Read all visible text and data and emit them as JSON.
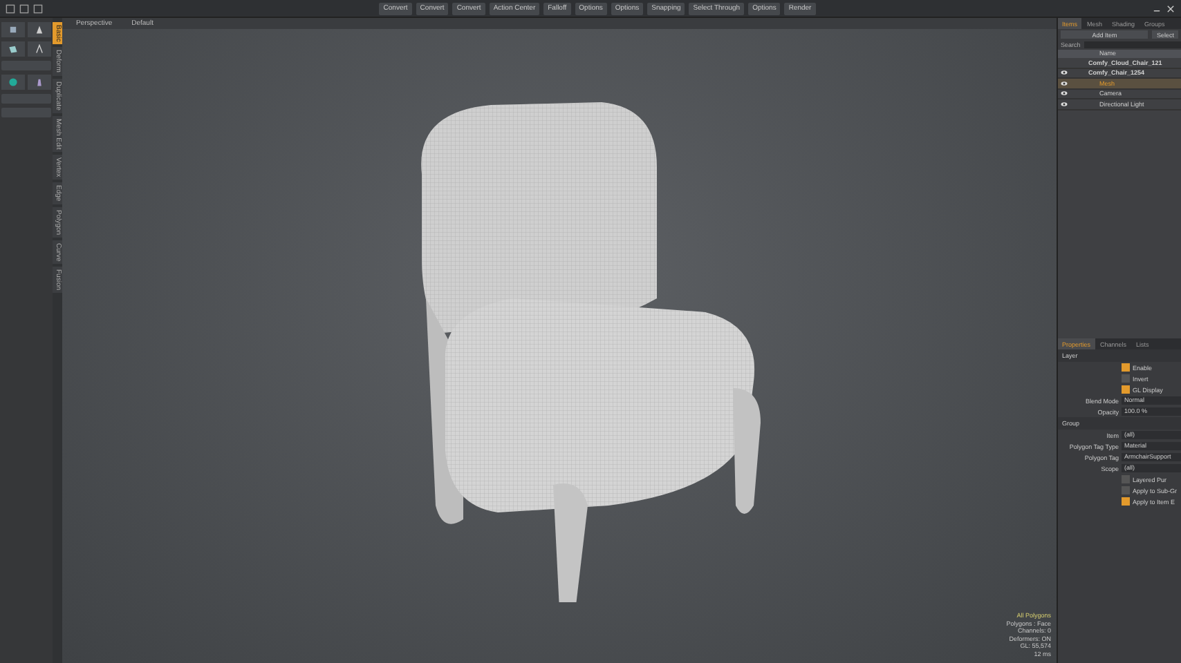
{
  "toolbar": {
    "buttons": [
      {
        "label": "Convert"
      },
      {
        "label": "Convert"
      },
      {
        "label": "Convert"
      },
      {
        "label": "Action Center"
      },
      {
        "label": "Falloff"
      },
      {
        "label": "Options"
      },
      {
        "label": "Options"
      },
      {
        "label": "Snapping"
      },
      {
        "label": "Select Through"
      },
      {
        "label": "Options"
      },
      {
        "label": "Render"
      }
    ]
  },
  "tool_tabs": [
    {
      "label": "Basic",
      "selected": true
    },
    {
      "label": "Deform",
      "selected": false
    },
    {
      "label": "Duplicate",
      "selected": false
    },
    {
      "label": "Mesh Edit",
      "selected": false
    },
    {
      "label": "Vertex",
      "selected": false
    },
    {
      "label": "Edge",
      "selected": false
    },
    {
      "label": "Polygon",
      "selected": false
    },
    {
      "label": "Curve",
      "selected": false
    },
    {
      "label": "Fusion",
      "selected": false
    }
  ],
  "viewport": {
    "view": "Perspective",
    "style": "Default",
    "stats": [
      {
        "text": "All Polygons",
        "kind": "highlight"
      },
      {
        "text": "Polygons : Face",
        "kind": "plain"
      },
      {
        "text": "Channels: 0",
        "kind": "plain"
      },
      {
        "text": "Deformers: ON",
        "kind": "plain"
      },
      {
        "text": "GL: 55,574",
        "kind": "plain"
      },
      {
        "text": "12 ms",
        "kind": "plain"
      }
    ]
  },
  "right_panel": {
    "tabs": [
      {
        "label": "Items",
        "selected": true
      },
      {
        "label": "Mesh",
        "selected": false
      },
      {
        "label": "Shading",
        "selected": false
      },
      {
        "label": "Groups",
        "selected": false
      }
    ],
    "add_item": "Add Item",
    "select": "Select",
    "search_label": "Search",
    "name_column": "Name",
    "items": [
      {
        "name": "Comfy_Cloud_Chair_121",
        "eye": false,
        "selected": false
      },
      {
        "name": "Comfy_Chair_1254",
        "eye": true,
        "selected": false,
        "children": [
          {
            "name": "Mesh",
            "eye": true,
            "selected": true
          },
          {
            "name": "Camera",
            "eye": true,
            "selected": false
          },
          {
            "name": "Directional Light",
            "eye": true,
            "selected": false
          }
        ]
      }
    ],
    "prop_tabs": [
      {
        "label": "Properties",
        "selected": true
      },
      {
        "label": "Channels",
        "selected": false
      },
      {
        "label": "Lists",
        "selected": false
      }
    ],
    "sections": [
      {
        "title": "Layer",
        "rows": [
          {
            "kind": "check",
            "label": "Enable",
            "checked": true
          },
          {
            "kind": "check",
            "label": "Invert",
            "checked": false
          },
          {
            "kind": "check",
            "label": "GL Display",
            "checked": true
          },
          {
            "kind": "field",
            "label": "Blend Mode",
            "value": "Normal"
          },
          {
            "kind": "field",
            "label": "Opacity",
            "value": "100.0 %"
          }
        ]
      },
      {
        "title": "Group",
        "rows": [
          {
            "kind": "field",
            "label": "Item",
            "value": "(all)"
          },
          {
            "kind": "field",
            "label": "Polygon Tag Type",
            "value": "Material"
          },
          {
            "kind": "field",
            "label": "Polygon Tag",
            "value": "ArmchairSupport"
          },
          {
            "kind": "field",
            "label": "Scope",
            "value": "(all)"
          },
          {
            "kind": "check",
            "label": "Layered Pur",
            "checked": false
          },
          {
            "kind": "check",
            "label": "Apply to Sub-Gr",
            "checked": false
          },
          {
            "kind": "check",
            "label": "Apply to Item E",
            "checked": true
          }
        ]
      }
    ]
  }
}
